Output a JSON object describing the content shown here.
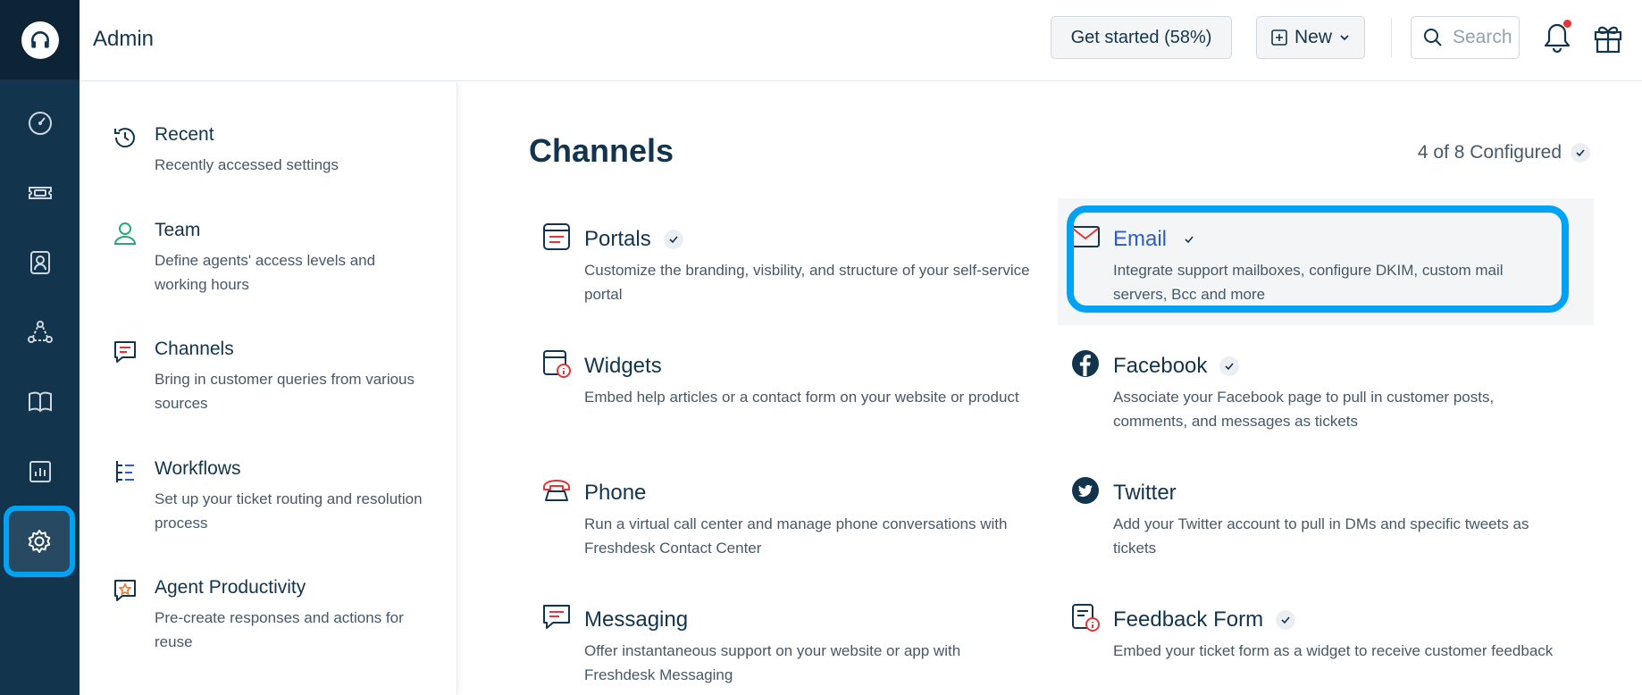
{
  "app": {
    "title": "Admin"
  },
  "header": {
    "get_started_label": "Get started (58%)",
    "new_label": "New",
    "search_placeholder": "Search"
  },
  "sidebar": {
    "items": [
      {
        "title": "Recent",
        "desc": "Recently accessed settings"
      },
      {
        "title": "Team",
        "desc": "Define agents' access levels and working hours"
      },
      {
        "title": "Channels",
        "desc": "Bring in customer queries from various sources"
      },
      {
        "title": "Workflows",
        "desc": "Set up your ticket routing and resolution process"
      },
      {
        "title": "Agent Productivity",
        "desc": "Pre-create responses and actions for reuse"
      }
    ]
  },
  "main": {
    "title": "Channels",
    "configured": "4 of 8 Configured",
    "channels": [
      {
        "title": "Portals",
        "desc": "Customize the branding, visbility, and structure of your self-service portal",
        "configured": true
      },
      {
        "title": "Email",
        "desc": "Integrate support mailboxes, configure DKIM, custom mail servers, Bcc and more",
        "configured": true
      },
      {
        "title": "Widgets",
        "desc": "Embed help articles or a contact form on your website or product",
        "configured": false
      },
      {
        "title": "Facebook",
        "desc": "Associate your Facebook page to pull in customer posts, comments, and messages as tickets",
        "configured": true
      },
      {
        "title": "Phone",
        "desc": "Run a virtual call center and manage phone conversations with Freshdesk Contact Center",
        "configured": false
      },
      {
        "title": "Twitter",
        "desc": "Add your Twitter account to pull in DMs and specific tweets as tickets",
        "configured": false
      },
      {
        "title": "Messaging",
        "desc": "Offer instantaneous support on your website or app with Freshdesk Messaging",
        "configured": false
      },
      {
        "title": "Feedback Form",
        "desc": "Embed your ticket form as a widget to receive customer feedback",
        "configured": true
      }
    ]
  },
  "colors": {
    "rail_bg": "#12344d",
    "highlight": "#00a2f4",
    "link_blue": "#2c5cc5",
    "icon_red": "#e43538",
    "notification_dot": "#e43538"
  },
  "icons": {
    "rail": [
      "headset-logo-icon",
      "dashboard-icon",
      "ticket-icon",
      "contacts-icon",
      "groups-icon",
      "book-icon",
      "reports-icon",
      "gear-icon"
    ],
    "channels": [
      "portal-icon",
      "email-icon",
      "widget-icon",
      "facebook-icon",
      "phone-icon",
      "twitter-icon",
      "messaging-icon",
      "feedback-form-icon"
    ]
  }
}
